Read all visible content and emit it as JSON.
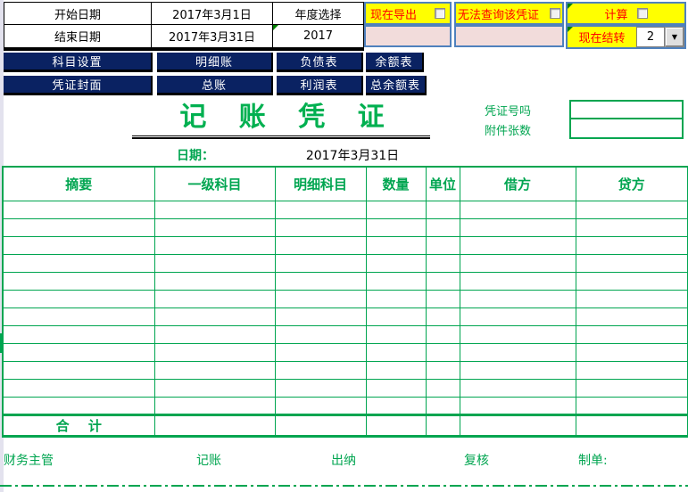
{
  "top_form": {
    "start_date_label": "开始日期",
    "start_date_value": "2017年3月1日",
    "end_date_label": "结束日期",
    "end_date_value": "2017年3月31日",
    "year_select_label": "年度选择",
    "year_value": "2017"
  },
  "controls": {
    "export_now_label": "现在导出",
    "cannot_query_label": "无法查询该凭证",
    "calculate_label": "计算",
    "carry_forward_label": "现在结转",
    "carry_forward_value": "2"
  },
  "nav": {
    "row1": [
      "科目设置",
      "明细账",
      "负债表",
      "余额表"
    ],
    "row2": [
      "凭证封面",
      "总账",
      "利润表",
      "总余额表"
    ]
  },
  "voucher": {
    "title": "记 账 凭 证",
    "voucher_no_label": "凭证号吗",
    "attachment_count_label": "附件张数",
    "voucher_no_value": "",
    "attachment_count_value": "",
    "date_label": "日期：",
    "date_value": "2017年3月31日",
    "columns": [
      "摘要",
      "一级科目",
      "明细科目",
      "数量",
      "单位",
      "借方",
      "贷方"
    ],
    "total_label": "合 计",
    "empty_row_count": 12
  },
  "signatures": {
    "labels": [
      "财务主管",
      "记账",
      "出纳",
      "复核",
      "制单:"
    ]
  },
  "icons": {
    "dropdown_arrow_glyph": "▼",
    "comment_indicator": "green-corner-triangle"
  },
  "colors": {
    "accent_green": "#00A550",
    "title_green": "#00B050",
    "button_navy": "#0A2262",
    "highlight_yellow": "#FFFF00",
    "alert_red": "#FF0000",
    "pink_cell": "#F2DCDB",
    "control_border_blue": "#4F81BD"
  }
}
